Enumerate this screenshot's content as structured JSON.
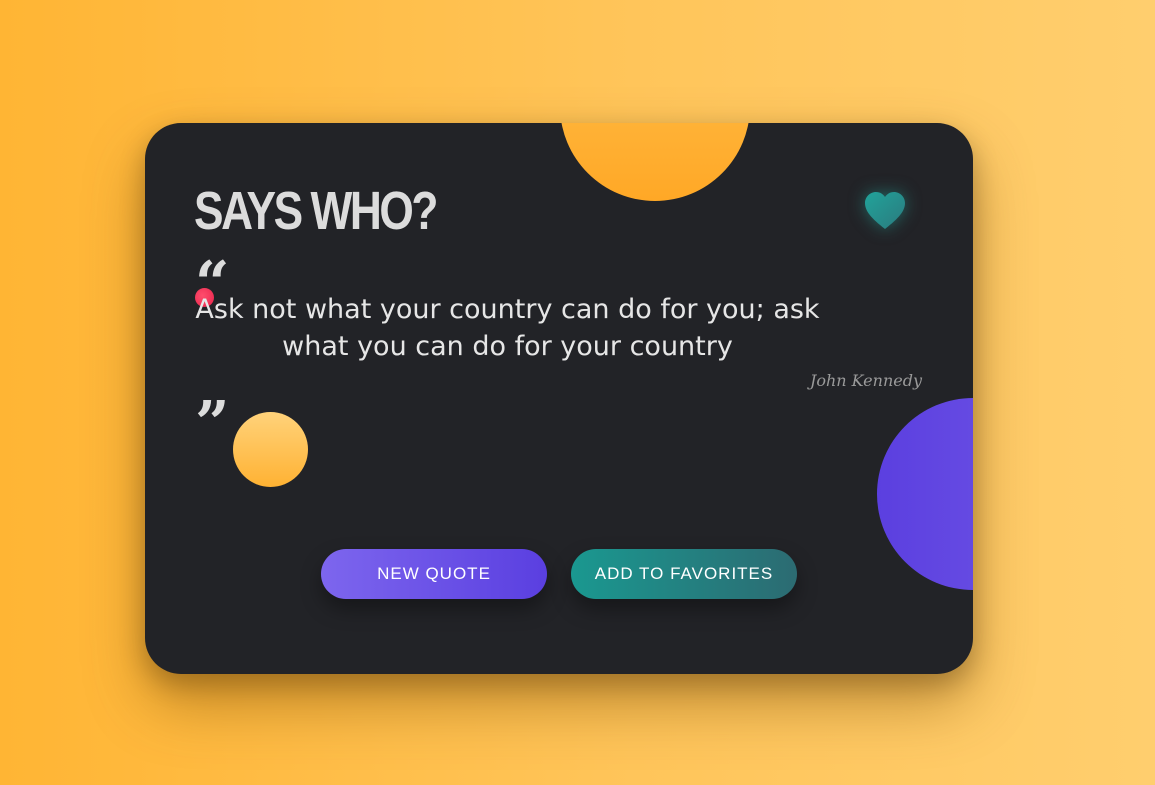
{
  "app": {
    "title": "SAYS WHO?"
  },
  "quote": {
    "open_mark": "“",
    "text": "Ask not what your country can do for you; ask what you can do for your country",
    "close_mark": "”",
    "author": "John Kennedy"
  },
  "actions": {
    "new_quote_label": "NEW QUOTE",
    "add_favorites_label": "ADD TO FAVORITES"
  },
  "icons": {
    "favorite": "heart-icon"
  },
  "colors": {
    "background": "#ffb534",
    "card": "#222327",
    "accent_orange": "#ffa826",
    "accent_purple": "#5b3fe0",
    "accent_teal": "#1a9890",
    "accent_red": "#e8234a"
  }
}
